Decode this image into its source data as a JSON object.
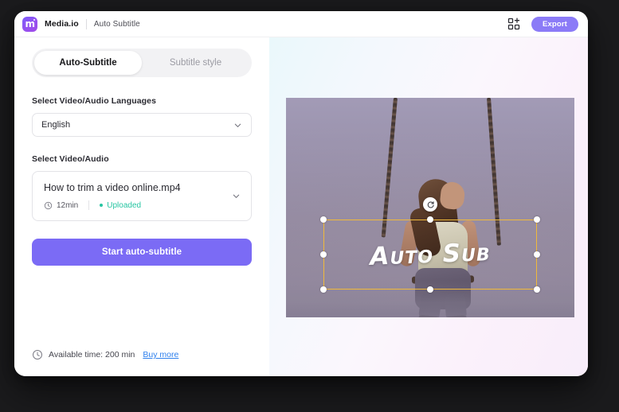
{
  "titlebar": {
    "brand_name": "Media.io",
    "doc_title": "Auto Subtitle",
    "grid_icon": "grid-apps-icon",
    "export_label": "Export"
  },
  "tabs": [
    {
      "label": "Auto-Subtitle",
      "active": true
    },
    {
      "label": "Subtitle style",
      "active": false
    }
  ],
  "language_section": {
    "label": "Select Video/Audio Languages",
    "selected": "English",
    "chevron_icon": "chevron-down-icon"
  },
  "media_section": {
    "label": "Select Video/Audio",
    "file_name": "How to trim a video online.mp4",
    "clock_icon": "clock-icon",
    "duration": "12min",
    "status": "Uploaded",
    "status_color": "#27C5A2",
    "chevron_icon": "chevron-down-icon"
  },
  "cta": {
    "start_label": "Start auto-subtitle",
    "color": "#7B6BF5"
  },
  "footer": {
    "clock_icon": "clock-icon",
    "available_time": "Available time: 200 min",
    "buy_more_label": "Buy more",
    "link_color": "#2F80ED"
  },
  "preview": {
    "subtitle_text": "Auto Sub",
    "selection_color": "#F0B93B",
    "rotate_icon": "rotate-refresh-icon",
    "handle_count": 8
  }
}
